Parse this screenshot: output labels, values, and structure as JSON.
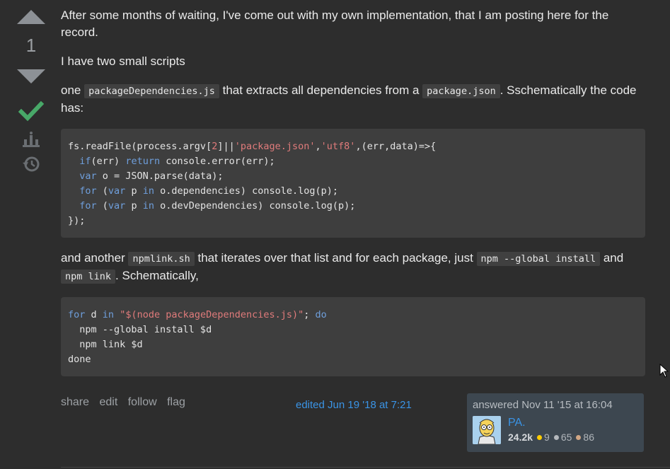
{
  "vote": {
    "count": "1"
  },
  "post": {
    "p1": "After some months of waiting, I've come out with my own implementation, that I am posting here for the record.",
    "p2": "I have two small scripts",
    "p3_a": "one ",
    "p3_code1": "packageDependencies.js",
    "p3_b": " that extracts all dependencies from a ",
    "p3_code2": "package.json",
    "p3_c": ". Sschematically the code has:",
    "code1": {
      "line1_a": "fs.readFile(process.argv[",
      "line1_num": "2",
      "line1_b": "]||",
      "line1_str1": "'package.json'",
      "line1_c": ",",
      "line1_str2": "'utf8'",
      "line1_d": ",(err,data)=>{",
      "line2_indent": "  ",
      "line2_kw1": "if",
      "line2_a": "(err) ",
      "line2_kw2": "return",
      "line2_b": " console.error(err);",
      "line3_indent": "  ",
      "line3_kw": "var",
      "line3_a": " o = JSON.parse(data);",
      "line4_indent": "  ",
      "line4_kw1": "for",
      "line4_a": " (",
      "line4_kw2": "var",
      "line4_b": " p ",
      "line4_kw3": "in",
      "line4_c": " o.dependencies) console.log(p);",
      "line5_indent": "  ",
      "line5_kw1": "for",
      "line5_a": " (",
      "line5_kw2": "var",
      "line5_b": " p ",
      "line5_kw3": "in",
      "line5_c": " o.devDependencies) console.log(p);",
      "line6": "});"
    },
    "p4_a": "and another ",
    "p4_code1": "npmlink.sh",
    "p4_b": " that iterates over that list and for each package, just ",
    "p4_code2": "npm --global install",
    "p4_c": " and ",
    "p4_code3": "npm link",
    "p4_d": ". Schematically,",
    "code2": {
      "line1_kw1": "for",
      "line1_a": " d ",
      "line1_kw2": "in",
      "line1_b": " ",
      "line1_str": "\"$(node packageDependencies.js)\"",
      "line1_c": "; ",
      "line1_kw3": "do",
      "line2": "  npm --global install $d",
      "line3": "  npm link $d",
      "line4": "done"
    }
  },
  "menu": {
    "share": "share",
    "edit": "edit",
    "follow": "follow",
    "flag": "flag"
  },
  "edited": "edited Jun 19 '18 at 7:21",
  "user": {
    "answered": "answered Nov 11 '15 at 16:04",
    "name": "PA.",
    "rep": "24.2k",
    "gold": "9",
    "silver": "65",
    "bronze": "86"
  },
  "colors": {
    "gold": "#ffcc01",
    "silver": "#b4b8bc",
    "bronze": "#d1a684"
  }
}
